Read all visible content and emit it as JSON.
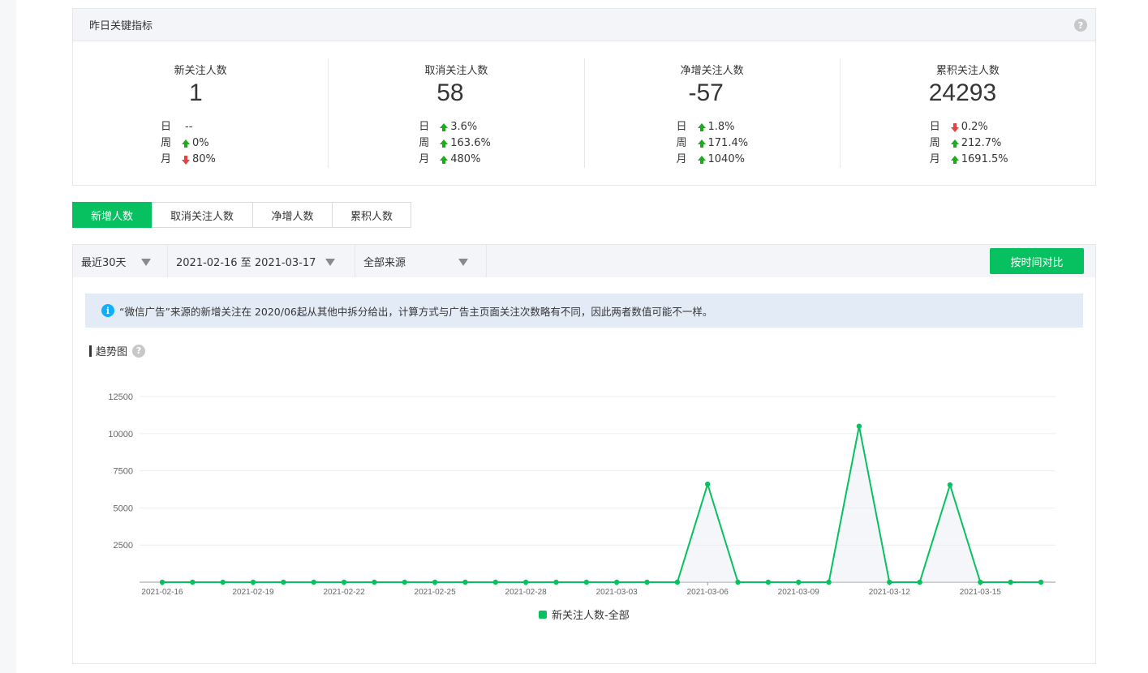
{
  "kpi_panel": {
    "title": "昨日关键指标",
    "help_glyph": "?",
    "metrics": [
      {
        "title": "新关注人数",
        "value": "1",
        "rows": [
          {
            "label": "日",
            "trend": "none",
            "text": "--"
          },
          {
            "label": "周",
            "trend": "up",
            "text": "0%"
          },
          {
            "label": "月",
            "trend": "down",
            "text": "80%"
          }
        ]
      },
      {
        "title": "取消关注人数",
        "value": "58",
        "rows": [
          {
            "label": "日",
            "trend": "up",
            "text": "3.6%"
          },
          {
            "label": "周",
            "trend": "up",
            "text": "163.6%"
          },
          {
            "label": "月",
            "trend": "up",
            "text": "480%"
          }
        ]
      },
      {
        "title": "净增关注人数",
        "value": "-57",
        "rows": [
          {
            "label": "日",
            "trend": "up",
            "text": "1.8%"
          },
          {
            "label": "周",
            "trend": "up",
            "text": "171.4%"
          },
          {
            "label": "月",
            "trend": "up",
            "text": "1040%"
          }
        ]
      },
      {
        "title": "累积关注人数",
        "value": "24293",
        "rows": [
          {
            "label": "日",
            "trend": "down",
            "text": "0.2%"
          },
          {
            "label": "周",
            "trend": "up",
            "text": "212.7%"
          },
          {
            "label": "月",
            "trend": "up",
            "text": "1691.5%"
          }
        ]
      }
    ]
  },
  "tabs": [
    {
      "label": "新增人数",
      "active": true
    },
    {
      "label": "取消关注人数",
      "active": false
    },
    {
      "label": "净增人数",
      "active": false
    },
    {
      "label": "累积人数",
      "active": false
    }
  ],
  "filters": {
    "period": "最近30天",
    "date_range": "2021-02-16 至 2021-03-17",
    "source": "全部来源",
    "compare_button": "按时间对比"
  },
  "notice": {
    "icon_glyph": "i",
    "text": "“微信广告”来源的新增关注在 2020/06起从其他中拆分给出，计算方式与广告主页面关注次数略有不同，因此两者数值可能不一样。"
  },
  "trend": {
    "title": "趋势图",
    "help_glyph": "?"
  },
  "colors": {
    "accent": "#07c160",
    "up": "#1aad19",
    "down": "#e64340",
    "notice_bg": "#e3ecf6"
  },
  "chart_data": {
    "type": "line",
    "title": "",
    "xlabel": "",
    "ylabel": "",
    "ylim": [
      0,
      12500
    ],
    "yticks": [
      2500,
      5000,
      7500,
      10000,
      12500
    ],
    "x": [
      "2021-02-16",
      "2021-02-17",
      "2021-02-18",
      "2021-02-19",
      "2021-02-20",
      "2021-02-21",
      "2021-02-22",
      "2021-02-23",
      "2021-02-24",
      "2021-02-25",
      "2021-02-26",
      "2021-02-27",
      "2021-02-28",
      "2021-03-01",
      "2021-03-02",
      "2021-03-03",
      "2021-03-04",
      "2021-03-05",
      "2021-03-06",
      "2021-03-07",
      "2021-03-08",
      "2021-03-09",
      "2021-03-10",
      "2021-03-11",
      "2021-03-12",
      "2021-03-13",
      "2021-03-14",
      "2021-03-15",
      "2021-03-16",
      "2021-03-17"
    ],
    "xtick_labels": [
      "2021-02-16",
      "2021-02-19",
      "2021-02-22",
      "2021-02-25",
      "2021-02-28",
      "2021-03-03",
      "2021-03-06",
      "2021-03-09",
      "2021-03-12",
      "2021-03-15"
    ],
    "series": [
      {
        "name": "新关注人数-全部",
        "values": [
          0,
          0,
          0,
          0,
          0,
          0,
          0,
          0,
          0,
          0,
          0,
          0,
          0,
          0,
          0,
          0,
          0,
          0,
          6600,
          0,
          0,
          0,
          0,
          10500,
          0,
          0,
          6550,
          0,
          0,
          0
        ]
      }
    ],
    "grid": true,
    "legend": "bottom-center"
  }
}
